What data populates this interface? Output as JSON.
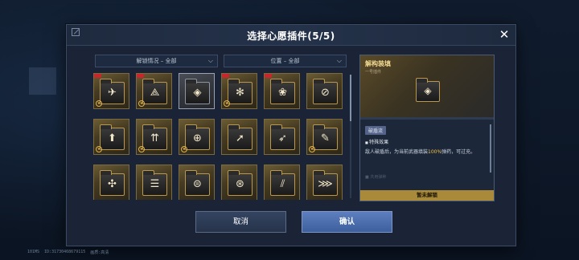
{
  "dialog": {
    "title": "选择心愿插件(5/5)",
    "close_label": "✕"
  },
  "filters": [
    {
      "label": "解锁情况 – 全部",
      "chevron": "⌵"
    },
    {
      "label": "位置 – 全部",
      "chevron": "⌵"
    }
  ],
  "plugins": [
    {
      "glyph": "✈",
      "new": true,
      "star": true,
      "style": "gold"
    },
    {
      "glyph": "⟁",
      "new": true,
      "star": true,
      "style": "gold"
    },
    {
      "glyph": "◈",
      "new": false,
      "star": false,
      "style": "grey"
    },
    {
      "glyph": "✻",
      "new": true,
      "star": true,
      "style": "gold"
    },
    {
      "glyph": "❀",
      "new": true,
      "star": false,
      "style": "gold"
    },
    {
      "glyph": "⊘",
      "new": false,
      "star": false,
      "style": "gold"
    },
    {
      "glyph": "⬆",
      "new": false,
      "star": true,
      "style": "gold"
    },
    {
      "glyph": "⇈",
      "new": false,
      "star": true,
      "style": "gold"
    },
    {
      "glyph": "⊕",
      "new": false,
      "star": true,
      "style": "gold"
    },
    {
      "glyph": "➚",
      "new": false,
      "star": false,
      "style": "gold"
    },
    {
      "glyph": "➶",
      "new": false,
      "star": false,
      "style": "gold"
    },
    {
      "glyph": "✎",
      "new": false,
      "star": true,
      "style": "gold"
    },
    {
      "glyph": "✣",
      "new": false,
      "star": false,
      "style": "gold"
    },
    {
      "glyph": "☰",
      "new": false,
      "star": false,
      "style": "gold"
    },
    {
      "glyph": "⊜",
      "new": false,
      "star": false,
      "style": "gold"
    },
    {
      "glyph": "⊛",
      "new": false,
      "star": false,
      "style": "gold"
    },
    {
      "glyph": "⫽",
      "new": false,
      "star": false,
      "style": "gold"
    },
    {
      "glyph": "⋙",
      "new": false,
      "star": false,
      "style": "gold"
    }
  ],
  "detail": {
    "name": "解构装填",
    "slot": "一号插件",
    "glyph": "◈",
    "tag": "破盾流",
    "effect_title": "特殊效果",
    "effect_desc_pre": "敌人破盾后，为当前武器填装",
    "effect_desc_hl": "100%",
    "effect_desc_post": "弹药，可过充。",
    "faded_line": "■ 共用弹种",
    "locked_label": "暂未解锁"
  },
  "buttons": {
    "cancel": "取消",
    "confirm": "确认"
  },
  "footer": {
    "fps": "101MS",
    "uid": "ID:31730468679115",
    "extra": "画质:高清"
  }
}
